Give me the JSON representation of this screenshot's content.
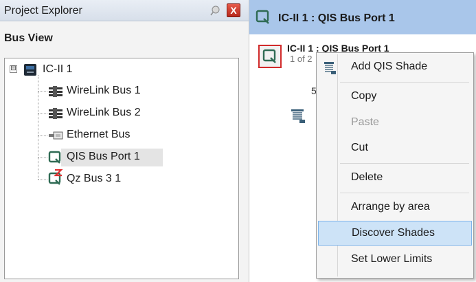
{
  "project_explorer": {
    "title": "Project Explorer",
    "close_glyph": "X",
    "bus_view_label": "Bus View"
  },
  "tree": {
    "root": {
      "label": "IC-II 1",
      "expander": "⊟",
      "icon": "controller-icon"
    },
    "children": [
      {
        "label": "WireLink Bus 1",
        "icon": "wirelink-bus-icon"
      },
      {
        "label": "WireLink Bus 2",
        "icon": "wirelink-bus-icon"
      },
      {
        "label": "Ethernet Bus",
        "icon": "ethernet-bus-icon"
      },
      {
        "label": "QIS Bus Port 1",
        "icon": "qis-port-icon",
        "selected": true
      },
      {
        "label": "Qz Bus 3 1",
        "icon": "qz-bus-icon"
      }
    ]
  },
  "right_panel": {
    "header_title": "IC-II 1 : QIS Bus Port 1",
    "port_name": "IC-II 1 : QIS Bus Port 1",
    "port_subtitle": "1 of 2",
    "background_digit": "5"
  },
  "context_menu": {
    "items": [
      {
        "label": "Add QIS Shade",
        "icon": "add-shade-icon"
      },
      {
        "label": "Copy"
      },
      {
        "label": "Paste",
        "disabled": true
      },
      {
        "label": "Cut"
      },
      {
        "label": "Delete"
      },
      {
        "label": "Arrange by area"
      },
      {
        "label": "Discover Shades",
        "highlighted": true
      },
      {
        "label": "Set Lower Limits"
      }
    ]
  },
  "colors": {
    "header_accent": "#a9c6ea",
    "highlight": "#cde3f7",
    "port_tile_border": "#d12a2a",
    "qz_red": "#e03030",
    "port_green": "#2f6b54"
  }
}
